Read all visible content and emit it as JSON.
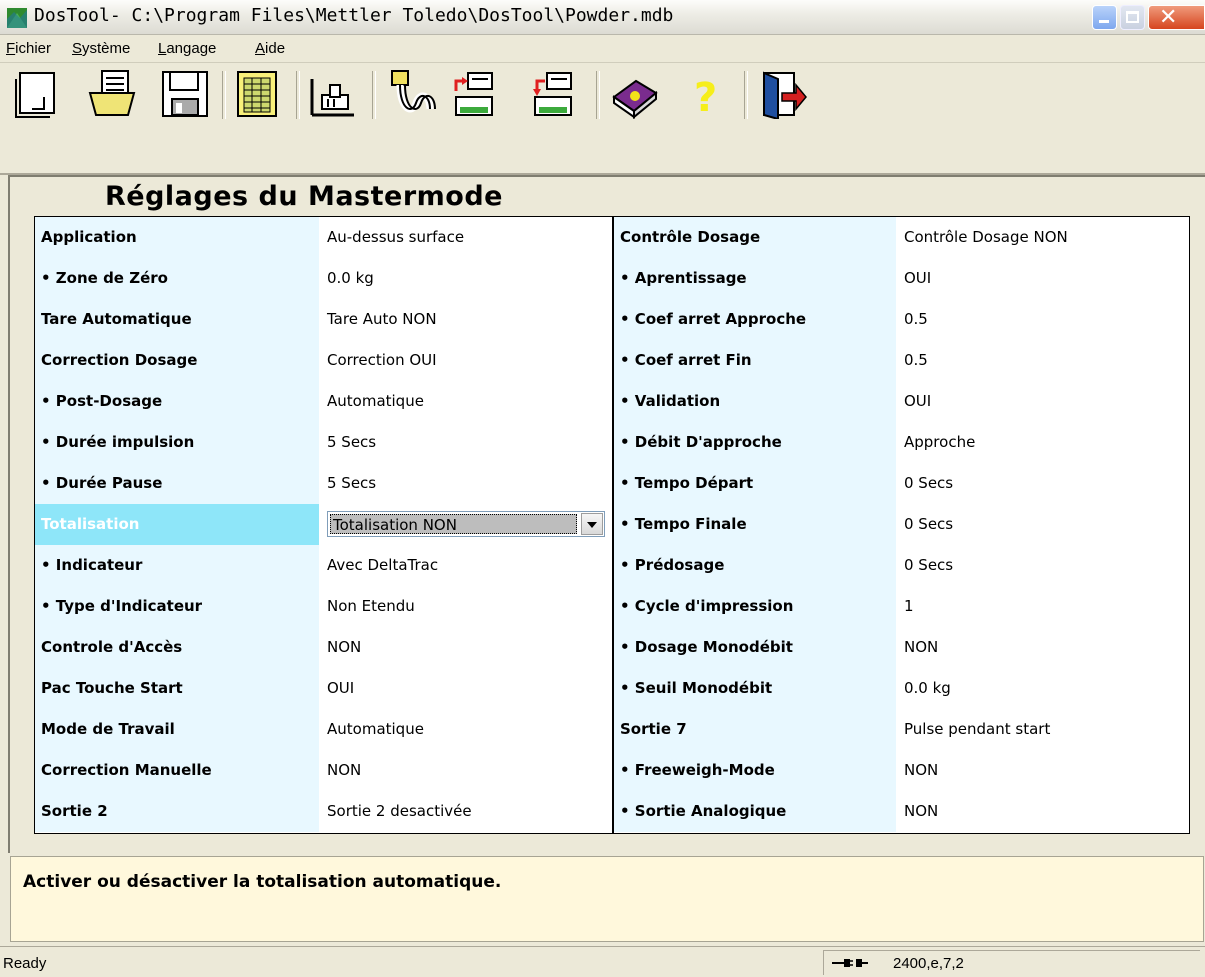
{
  "window": {
    "title": "DosTool- C:\\Program Files\\Mettler Toledo\\DosTool\\Powder.mdb",
    "app_icon": "dostool-app-icon",
    "controls": [
      "minimize-icon",
      "maximize-icon",
      "close-icon"
    ]
  },
  "menubar": {
    "items": [
      {
        "mnemonic": "F",
        "rest": "ichier"
      },
      {
        "mnemonic": "S",
        "rest": "ystème"
      },
      {
        "mnemonic": "L",
        "rest": "angage"
      },
      {
        "mnemonic": "A",
        "rest": "ide"
      }
    ]
  },
  "toolbar": {
    "buttons": [
      "new-document-icon",
      "open-icon",
      "save-icon",
      "table-icon",
      "scale-icon",
      "cable-icon",
      "upload-to-device-icon",
      "download-from-device-icon",
      "help-book-icon",
      "question-mark-icon",
      "exit-door-icon"
    ]
  },
  "main": {
    "heading": "Réglages du Mastermode",
    "left_rows": [
      {
        "label": "Application",
        "value": "Au-dessus surface"
      },
      {
        "label": "• Zone de Zéro",
        "value": "0.0 kg"
      },
      {
        "label": "Tare Automatique",
        "value": "Tare Auto NON"
      },
      {
        "label": "Correction Dosage",
        "value": "Correction OUI"
      },
      {
        "label": "• Post-Dosage",
        "value": "Automatique"
      },
      {
        "label": "• Durée impulsion",
        "value": "5 Secs"
      },
      {
        "label": "• Durée Pause",
        "value": "5 Secs"
      },
      {
        "label": "Totalisation",
        "value": "Totalisation NON",
        "selected": true
      },
      {
        "label": "• Indicateur",
        "value": "Avec DeltaTrac"
      },
      {
        "label": "• Type d'Indicateur",
        "value": "Non Etendu"
      },
      {
        "label": "Controle d'Accès",
        "value": "NON"
      },
      {
        "label": "Pac Touche Start",
        "value": "OUI"
      },
      {
        "label": "Mode de Travail",
        "value": "Automatique"
      },
      {
        "label": "Correction Manuelle",
        "value": "NON"
      },
      {
        "label": "Sortie 2",
        "value": "Sortie 2 desactivée"
      }
    ],
    "right_rows": [
      {
        "label": "Contrôle Dosage",
        "value": "Contrôle Dosage NON"
      },
      {
        "label": "• Aprentissage",
        "value": "OUI"
      },
      {
        "label": "• Coef arret Approche",
        "value": "0.5"
      },
      {
        "label": "• Coef arret Fin",
        "value": "0.5"
      },
      {
        "label": "• Validation",
        "value": "OUI"
      },
      {
        "label": "• Débit D'approche",
        "value": "Approche"
      },
      {
        "label": "• Tempo Départ",
        "value": "0 Secs"
      },
      {
        "label": "• Tempo Finale",
        "value": "0 Secs"
      },
      {
        "label": "• Prédosage",
        "value": "0 Secs"
      },
      {
        "label": "• Cycle d'impression",
        "value": "1"
      },
      {
        "label": "• Dosage Monodébit",
        "value": "NON"
      },
      {
        "label": "• Seuil Monodébit",
        "value": "0.0 kg"
      },
      {
        "label": "Sortie 7",
        "value": "Pulse pendant start"
      },
      {
        "label": "• Freeweigh-Mode",
        "value": "NON"
      },
      {
        "label": "• Sortie Analogique",
        "value": "NON"
      }
    ]
  },
  "help": {
    "text": "Activer ou désactiver la totalisation automatique."
  },
  "statusbar": {
    "left": "Ready",
    "connection_icon": "serial-connection-icon",
    "right": "2400,e,7,2"
  },
  "colors": {
    "label_bg": "#e8f8ff",
    "selected_label_bg": "#8ee6f9",
    "help_bg": "#fff8dc",
    "window_bg": "#ece9d8"
  }
}
